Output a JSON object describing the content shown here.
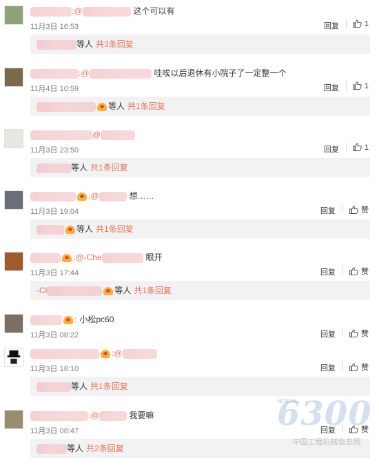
{
  "comments": [
    {
      "head": "这个可以有",
      "mention_prefix": ":@",
      "time": "11月3日 16:53",
      "reply": "回复",
      "like_label": "1",
      "like_style": "count",
      "sub": {
        "suffix": "等人",
        "count": "共3条回复"
      }
    },
    {
      "head": "哇唉以后退休有小院子了一定整一个",
      "mention_prefix": ":@",
      "time": "11月4日 10:59",
      "reply": "回复",
      "like_label": "1",
      "like_style": "count",
      "sub": {
        "suffix": "等人",
        "count": "共1条回复"
      }
    },
    {
      "head": "",
      "mention_prefix": "@",
      "time": "11月3日 23:50",
      "reply": "回复",
      "like_label": "1",
      "like_style": "count",
      "sub": {
        "suffix": "等人",
        "count": "共1条回复"
      }
    },
    {
      "head": "想……",
      "mention_prefix": ":@",
      "time": "11月3日 19:04",
      "reply": "回复",
      "like_label": "赞",
      "like_style": "zan",
      "sub": {
        "suffix": "等人",
        "count": "共1条回复"
      }
    },
    {
      "head": "眼开",
      "mention_prefix": ":@-Che",
      "time": "11月3日 17:44",
      "reply": "回复",
      "like_label": "赞",
      "like_style": "zan",
      "sub": {
        "prefix": "-Cl",
        "suffix": "等人",
        "count": "共1条回复"
      }
    },
    {
      "head": "小松pc60",
      "mention_prefix": ":",
      "time": "11月3日 08:22",
      "reply": "回复",
      "like_label": "赞",
      "like_style": "zan",
      "sub": null
    },
    {
      "head": "",
      "mention_prefix": ":@",
      "time": "11月3日 18:10",
      "reply": "回复",
      "like_label": "赞",
      "like_style": "zan",
      "sub": {
        "suffix": "等人",
        "count": "共1条回复"
      }
    },
    {
      "head": "我要嘛",
      "mention_prefix": ":@",
      "time": "11月3日 08:47",
      "reply": "回复",
      "like_label": "赞",
      "like_style": "zan",
      "sub": {
        "suffix": "等人",
        "count": "共2条回复"
      }
    }
  ],
  "watermark": {
    "www": "www.",
    "logo": "6300",
    "text": "中国工程机械信息网"
  },
  "colors": {
    "accent": "#eb7350",
    "sub_bg": "#f2f2f5",
    "time": "#808080"
  }
}
